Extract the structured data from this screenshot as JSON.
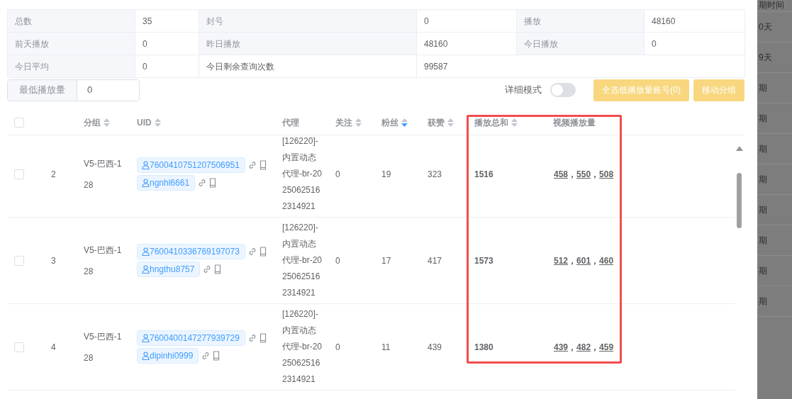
{
  "stats": [
    {
      "cells": [
        {
          "label": "总数",
          "value": "35"
        },
        {
          "label": "封号",
          "value": "0"
        },
        {
          "label": "播放",
          "value": "48160"
        }
      ]
    },
    {
      "cells": [
        {
          "label": "前天播放",
          "value": "0"
        },
        {
          "label": "昨日播放",
          "value": "48160"
        },
        {
          "label": "今日播放",
          "value": "0"
        }
      ]
    },
    {
      "cells": [
        {
          "label": "今日平均",
          "value": "0"
        },
        {
          "label": "今日剩余查询次数",
          "value": "99587"
        }
      ]
    }
  ],
  "min_plays": {
    "label": "最低播放量",
    "value": "0"
  },
  "detail_mode": {
    "label": "详细模式",
    "on": false
  },
  "buttons": [
    {
      "label": "全选低播放量账号(0)",
      "disabled": true
    },
    {
      "label": "移动分组",
      "disabled": true
    }
  ],
  "table": {
    "header_checkbox": {
      "checked": false
    },
    "columns": [
      {
        "label": "分组",
        "sortable": true,
        "sorted_desc": false
      },
      {
        "label": "UID",
        "sortable": true,
        "sorted_desc": false
      },
      {
        "label": "代理",
        "sortable": false
      },
      {
        "label": "关注",
        "sortable": true,
        "sorted_desc": false
      },
      {
        "label": "粉丝",
        "sortable": true,
        "sorted_desc": true
      },
      {
        "label": "获赞",
        "sortable": true,
        "sorted_desc": false
      },
      {
        "label": "播放总和",
        "sortable": true,
        "sorted_desc": false
      },
      {
        "label": "视频播放量",
        "sortable": false
      }
    ],
    "separator": "，",
    "rows": [
      {
        "selected": false,
        "index": "2",
        "group": "V5-巴西-128",
        "uids": [
          "7600410751207506951",
          "ngnhl6661"
        ],
        "proxy": "[126220]-内置动态代理-br-20250625162314921",
        "following": "0",
        "followers": "19",
        "likes": "323",
        "total_plays": "1516",
        "video_plays": [
          "458",
          "550",
          "508"
        ]
      },
      {
        "selected": false,
        "index": "3",
        "group": "V5-巴西-128",
        "uids": [
          "7600410336769197073",
          "hngthu8757"
        ],
        "proxy": "[126220]-内置动态代理-br-20250625162314921",
        "following": "0",
        "followers": "17",
        "likes": "417",
        "total_plays": "1573",
        "video_plays": [
          "512",
          "601",
          "460"
        ]
      },
      {
        "selected": false,
        "index": "4",
        "group": "V5-巴西-128",
        "uids": [
          "7600400147277939729",
          "dipinhi0999"
        ],
        "proxy": "[126220]-内置动态代理-br-20250625162314921",
        "following": "0",
        "followers": "11",
        "likes": "439",
        "total_plays": "1380",
        "video_plays": [
          "439",
          "482",
          "459"
        ]
      }
    ]
  },
  "background_list": {
    "items": [
      "期时间",
      "0天",
      "9天",
      "期",
      "期",
      "期",
      "期",
      "期",
      "期",
      "期",
      "期"
    ]
  }
}
